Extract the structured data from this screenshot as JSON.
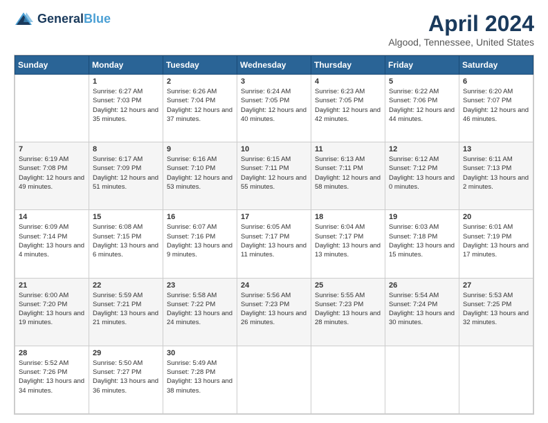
{
  "logo": {
    "line1": "General",
    "line2": "Blue"
  },
  "title": "April 2024",
  "subtitle": "Algood, Tennessee, United States",
  "weekdays": [
    "Sunday",
    "Monday",
    "Tuesday",
    "Wednesday",
    "Thursday",
    "Friday",
    "Saturday"
  ],
  "weeks": [
    [
      {
        "day": "",
        "sunrise": "",
        "sunset": "",
        "daylight": ""
      },
      {
        "day": "1",
        "sunrise": "Sunrise: 6:27 AM",
        "sunset": "Sunset: 7:03 PM",
        "daylight": "Daylight: 12 hours and 35 minutes."
      },
      {
        "day": "2",
        "sunrise": "Sunrise: 6:26 AM",
        "sunset": "Sunset: 7:04 PM",
        "daylight": "Daylight: 12 hours and 37 minutes."
      },
      {
        "day": "3",
        "sunrise": "Sunrise: 6:24 AM",
        "sunset": "Sunset: 7:05 PM",
        "daylight": "Daylight: 12 hours and 40 minutes."
      },
      {
        "day": "4",
        "sunrise": "Sunrise: 6:23 AM",
        "sunset": "Sunset: 7:05 PM",
        "daylight": "Daylight: 12 hours and 42 minutes."
      },
      {
        "day": "5",
        "sunrise": "Sunrise: 6:22 AM",
        "sunset": "Sunset: 7:06 PM",
        "daylight": "Daylight: 12 hours and 44 minutes."
      },
      {
        "day": "6",
        "sunrise": "Sunrise: 6:20 AM",
        "sunset": "Sunset: 7:07 PM",
        "daylight": "Daylight: 12 hours and 46 minutes."
      }
    ],
    [
      {
        "day": "7",
        "sunrise": "Sunrise: 6:19 AM",
        "sunset": "Sunset: 7:08 PM",
        "daylight": "Daylight: 12 hours and 49 minutes."
      },
      {
        "day": "8",
        "sunrise": "Sunrise: 6:17 AM",
        "sunset": "Sunset: 7:09 PM",
        "daylight": "Daylight: 12 hours and 51 minutes."
      },
      {
        "day": "9",
        "sunrise": "Sunrise: 6:16 AM",
        "sunset": "Sunset: 7:10 PM",
        "daylight": "Daylight: 12 hours and 53 minutes."
      },
      {
        "day": "10",
        "sunrise": "Sunrise: 6:15 AM",
        "sunset": "Sunset: 7:11 PM",
        "daylight": "Daylight: 12 hours and 55 minutes."
      },
      {
        "day": "11",
        "sunrise": "Sunrise: 6:13 AM",
        "sunset": "Sunset: 7:11 PM",
        "daylight": "Daylight: 12 hours and 58 minutes."
      },
      {
        "day": "12",
        "sunrise": "Sunrise: 6:12 AM",
        "sunset": "Sunset: 7:12 PM",
        "daylight": "Daylight: 13 hours and 0 minutes."
      },
      {
        "day": "13",
        "sunrise": "Sunrise: 6:11 AM",
        "sunset": "Sunset: 7:13 PM",
        "daylight": "Daylight: 13 hours and 2 minutes."
      }
    ],
    [
      {
        "day": "14",
        "sunrise": "Sunrise: 6:09 AM",
        "sunset": "Sunset: 7:14 PM",
        "daylight": "Daylight: 13 hours and 4 minutes."
      },
      {
        "day": "15",
        "sunrise": "Sunrise: 6:08 AM",
        "sunset": "Sunset: 7:15 PM",
        "daylight": "Daylight: 13 hours and 6 minutes."
      },
      {
        "day": "16",
        "sunrise": "Sunrise: 6:07 AM",
        "sunset": "Sunset: 7:16 PM",
        "daylight": "Daylight: 13 hours and 9 minutes."
      },
      {
        "day": "17",
        "sunrise": "Sunrise: 6:05 AM",
        "sunset": "Sunset: 7:17 PM",
        "daylight": "Daylight: 13 hours and 11 minutes."
      },
      {
        "day": "18",
        "sunrise": "Sunrise: 6:04 AM",
        "sunset": "Sunset: 7:17 PM",
        "daylight": "Daylight: 13 hours and 13 minutes."
      },
      {
        "day": "19",
        "sunrise": "Sunrise: 6:03 AM",
        "sunset": "Sunset: 7:18 PM",
        "daylight": "Daylight: 13 hours and 15 minutes."
      },
      {
        "day": "20",
        "sunrise": "Sunrise: 6:01 AM",
        "sunset": "Sunset: 7:19 PM",
        "daylight": "Daylight: 13 hours and 17 minutes."
      }
    ],
    [
      {
        "day": "21",
        "sunrise": "Sunrise: 6:00 AM",
        "sunset": "Sunset: 7:20 PM",
        "daylight": "Daylight: 13 hours and 19 minutes."
      },
      {
        "day": "22",
        "sunrise": "Sunrise: 5:59 AM",
        "sunset": "Sunset: 7:21 PM",
        "daylight": "Daylight: 13 hours and 21 minutes."
      },
      {
        "day": "23",
        "sunrise": "Sunrise: 5:58 AM",
        "sunset": "Sunset: 7:22 PM",
        "daylight": "Daylight: 13 hours and 24 minutes."
      },
      {
        "day": "24",
        "sunrise": "Sunrise: 5:56 AM",
        "sunset": "Sunset: 7:23 PM",
        "daylight": "Daylight: 13 hours and 26 minutes."
      },
      {
        "day": "25",
        "sunrise": "Sunrise: 5:55 AM",
        "sunset": "Sunset: 7:23 PM",
        "daylight": "Daylight: 13 hours and 28 minutes."
      },
      {
        "day": "26",
        "sunrise": "Sunrise: 5:54 AM",
        "sunset": "Sunset: 7:24 PM",
        "daylight": "Daylight: 13 hours and 30 minutes."
      },
      {
        "day": "27",
        "sunrise": "Sunrise: 5:53 AM",
        "sunset": "Sunset: 7:25 PM",
        "daylight": "Daylight: 13 hours and 32 minutes."
      }
    ],
    [
      {
        "day": "28",
        "sunrise": "Sunrise: 5:52 AM",
        "sunset": "Sunset: 7:26 PM",
        "daylight": "Daylight: 13 hours and 34 minutes."
      },
      {
        "day": "29",
        "sunrise": "Sunrise: 5:50 AM",
        "sunset": "Sunset: 7:27 PM",
        "daylight": "Daylight: 13 hours and 36 minutes."
      },
      {
        "day": "30",
        "sunrise": "Sunrise: 5:49 AM",
        "sunset": "Sunset: 7:28 PM",
        "daylight": "Daylight: 13 hours and 38 minutes."
      },
      {
        "day": "",
        "sunrise": "",
        "sunset": "",
        "daylight": ""
      },
      {
        "day": "",
        "sunrise": "",
        "sunset": "",
        "daylight": ""
      },
      {
        "day": "",
        "sunrise": "",
        "sunset": "",
        "daylight": ""
      },
      {
        "day": "",
        "sunrise": "",
        "sunset": "",
        "daylight": ""
      }
    ]
  ]
}
